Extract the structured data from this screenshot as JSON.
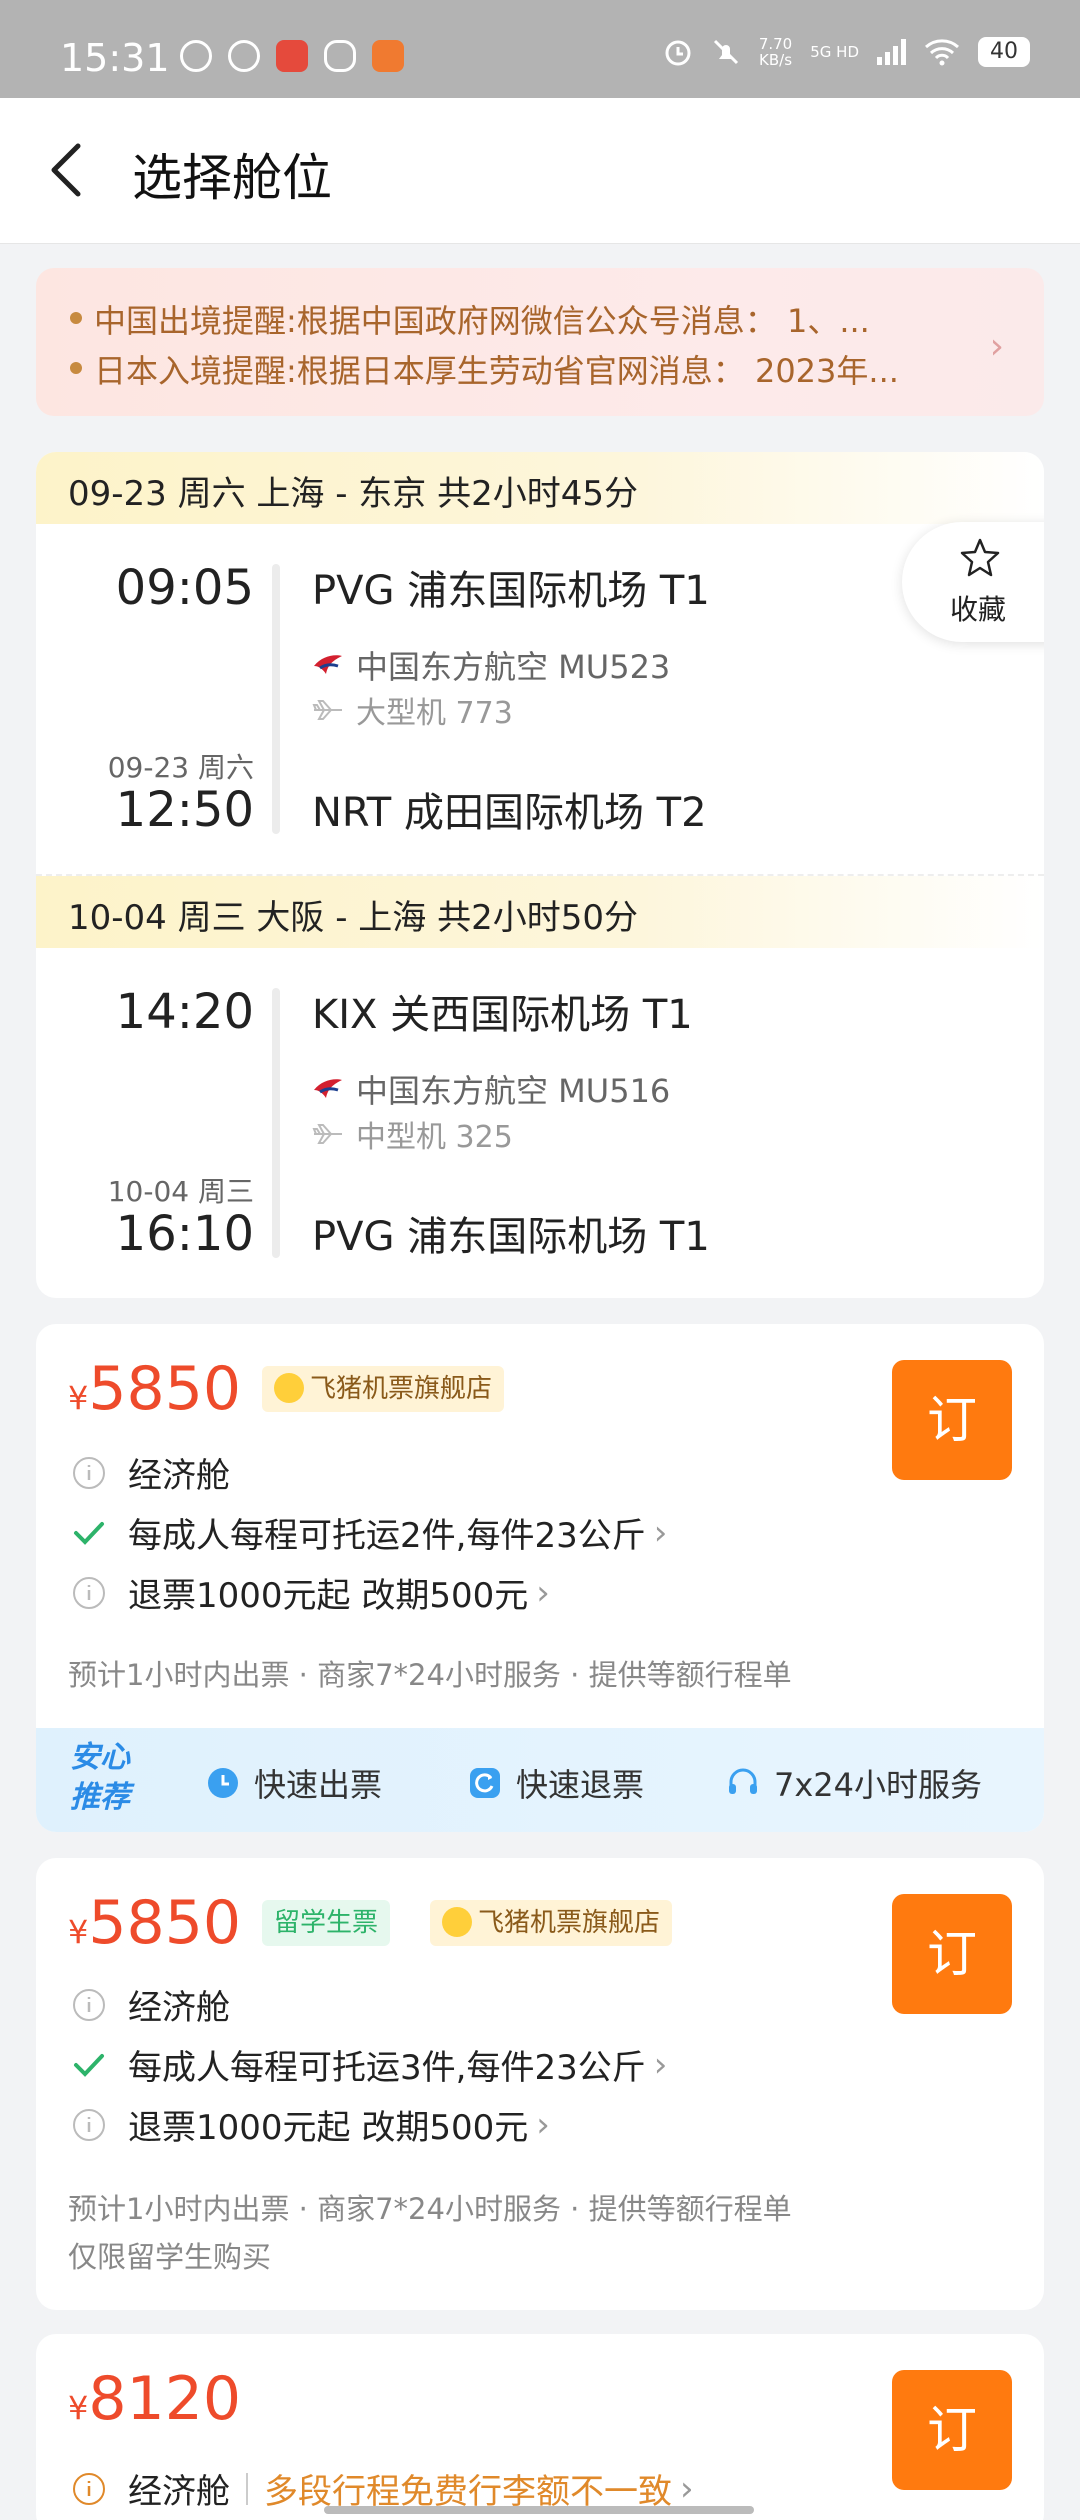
{
  "status_bar": {
    "time": "15:31",
    "net_speed": "7.70",
    "net_unit": "KB/s",
    "network": "5G HD",
    "battery": "40"
  },
  "header": {
    "title": "选择舱位"
  },
  "notice": {
    "line1": "中国出境提醒:根据中国政府网微信公众号消息：  1、...",
    "line2": "日本入境提醒:根据日本厚生劳动省官网消息：  2023年..."
  },
  "favorite": {
    "label": "收藏"
  },
  "legs": [
    {
      "header": "09-23  周六 上海 - 东京  共2小时45分",
      "dep_time": "09:05",
      "dep_airport": "PVG 浦东国际机场 T1",
      "airline": "中国东方航空 MU523",
      "plane": "大型机 773",
      "arr_date": "09-23 周六",
      "arr_time": "12:50",
      "arr_airport": "NRT 成田国际机场 T2"
    },
    {
      "header": "10-04  周三 大阪 - 上海  共2小时50分",
      "dep_time": "14:20",
      "dep_airport": "KIX 关西国际机场 T1",
      "airline": "中国东方航空 MU516",
      "plane": "中型机 325",
      "arr_date": "10-04 周三",
      "arr_time": "16:10",
      "arr_airport": "PVG 浦东国际机场 T1"
    }
  ],
  "fares": [
    {
      "currency": "¥",
      "price": "5850",
      "shop_tag": "飞猪机票旗舰店",
      "cabin": "经济舱",
      "baggage": "每成人每程可托运2件,每件23公斤",
      "refund": "退票1000元起  改期500元",
      "note1": "预计1小时内出票 · 商家7*24小时服务 · 提供等额行程单",
      "book": "订"
    },
    {
      "currency": "¥",
      "price": "5850",
      "student_tag": "留学生票",
      "shop_tag": "飞猪机票旗舰店",
      "cabin": "经济舱",
      "baggage": "每成人每程可托运3件,每件23公斤",
      "refund": "退票1000元起  改期500元",
      "note1": "预计1小时内出票 · 商家7*24小时服务 · 提供等额行程单",
      "note2": "仅限留学生购买",
      "book": "订"
    },
    {
      "currency": "¥",
      "price": "8120",
      "cabin": "经济舱",
      "warning": "多段行程免费行李额不一致",
      "book": "订"
    }
  ],
  "assurance": {
    "badge_line1": "安心",
    "badge_line2": "推荐",
    "items": [
      "快速出票",
      "快速退票",
      "7x24小时服务"
    ]
  },
  "colors": {
    "accent": "#ff7a0f",
    "price": "#ee4b2b",
    "assure_blue": "#2b8be6"
  }
}
